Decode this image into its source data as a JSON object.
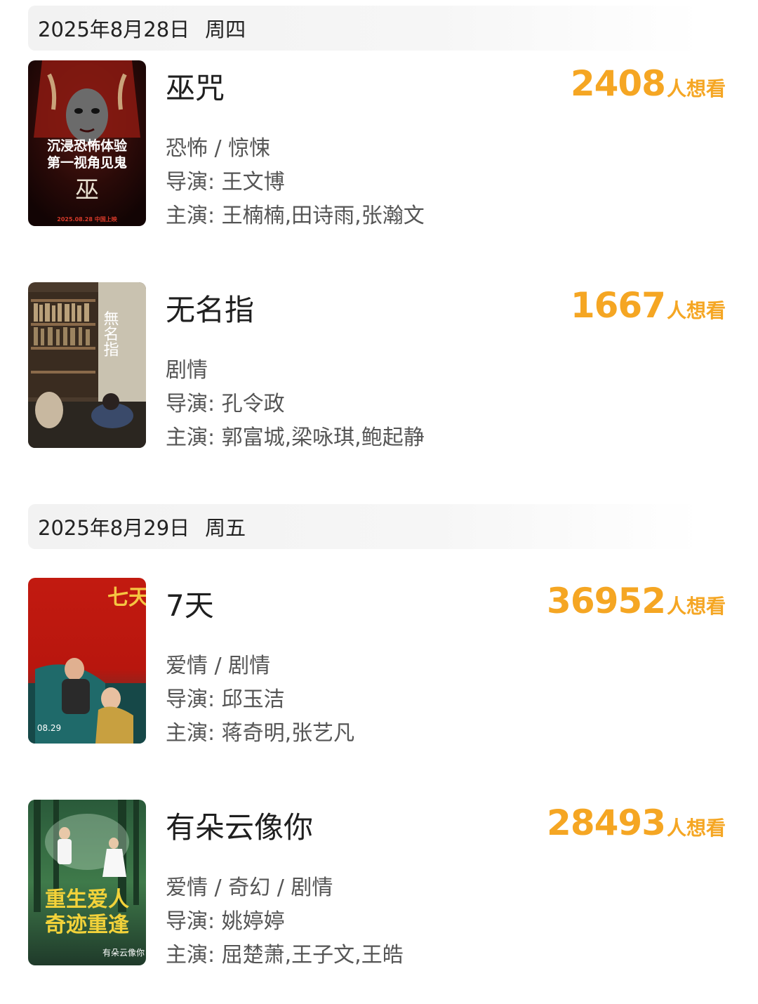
{
  "sections": [
    {
      "date": "2025年8月28日",
      "weekday": "周四",
      "movies": [
        {
          "title": "巫咒",
          "want_count": "2408",
          "want_unit": "人想看",
          "genres": "恐怖 / 惊悚",
          "director": "导演: 王文博",
          "cast": "主演: 王楠楠,田诗雨,张瀚文",
          "poster": {
            "line1": "沉浸恐怖体验",
            "line2": "第一视角见鬼",
            "seal": "巫",
            "footer": "2025.08.28 中国上映"
          }
        },
        {
          "title": "无名指",
          "want_count": "1667",
          "want_unit": "人想看",
          "genres": "剧情",
          "director": "导演: 孔令政",
          "cast": "主演: 郭富城,梁咏琪,鲍起静",
          "poster": {
            "line1": "無名指"
          }
        }
      ]
    },
    {
      "date": "2025年8月29日",
      "weekday": "周五",
      "movies": [
        {
          "title": "7天",
          "want_count": "36952",
          "want_unit": "人想看",
          "genres": "爱情 / 剧情",
          "director": "导演: 邱玉洁",
          "cast": "主演: 蒋奇明,张艺凡",
          "poster": {
            "line1": "七天",
            "footer": "08.29"
          }
        },
        {
          "title": "有朵云像你",
          "want_count": "28493",
          "want_unit": "人想看",
          "genres": "爱情 / 奇幻 / 剧情",
          "director": "导演: 姚婷婷",
          "cast": "主演: 屈楚萧,王子文,王皓",
          "poster": {
            "line1": "重生爱人",
            "line2": "奇迹重逢",
            "footer": "有朵云像你"
          }
        }
      ]
    }
  ]
}
